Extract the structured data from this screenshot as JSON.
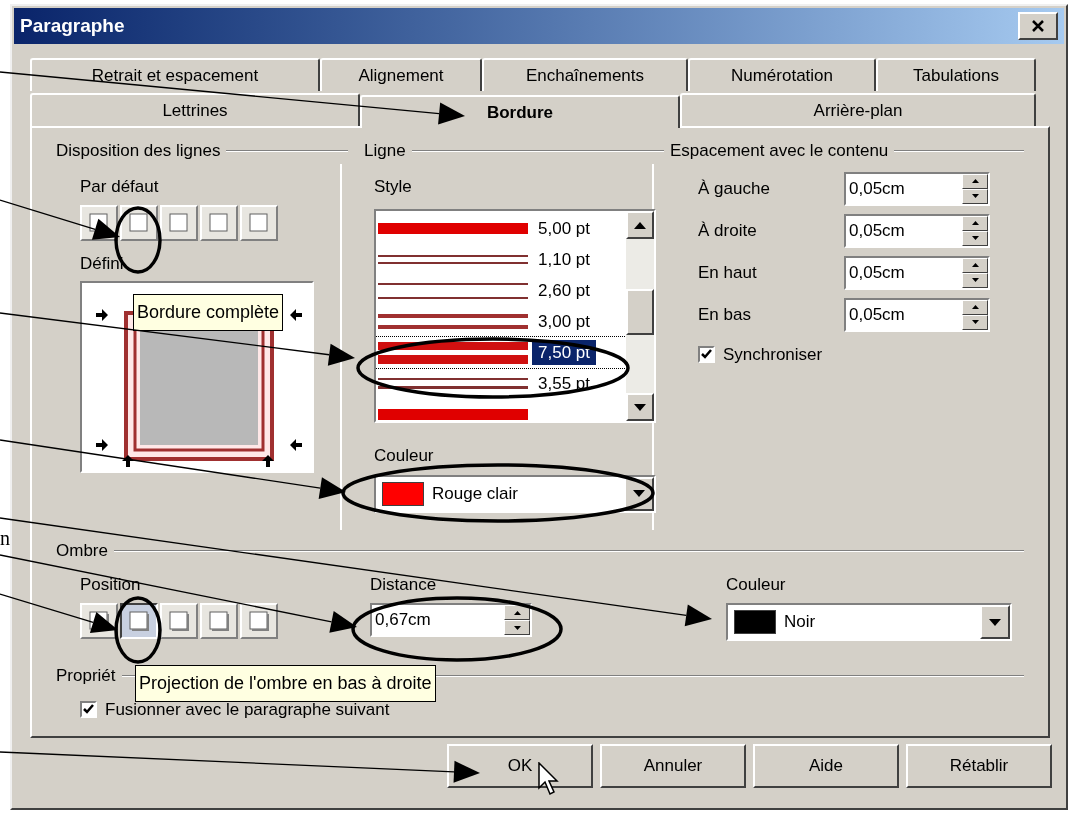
{
  "window": {
    "title": "Paragraphe"
  },
  "tabs_row_1": [
    {
      "label": "Retrait et espacement",
      "selected": false
    },
    {
      "label": "Alignement",
      "selected": false
    },
    {
      "label": "Enchaînements",
      "selected": false
    },
    {
      "label": "Numérotation",
      "selected": false
    },
    {
      "label": "Tabulations",
      "selected": false
    }
  ],
  "tabs_row_2": [
    {
      "label": "Lettrines",
      "selected": false
    },
    {
      "label": "Bordure",
      "selected": true
    },
    {
      "label": "Arrière-plan",
      "selected": false
    }
  ],
  "line_arrangement": {
    "title": "Disposition des lignes",
    "default_label": "Par défaut",
    "presets": [
      {
        "selected": false
      },
      {
        "selected": false
      },
      {
        "selected": false
      },
      {
        "selected": false
      },
      {
        "selected": false
      }
    ],
    "user_defined_label": "Défini"
  },
  "line": {
    "title": "Ligne",
    "style_label": "Style",
    "styles": [
      {
        "kind": "single_thick",
        "reading": "5,00 pt",
        "selected": false
      },
      {
        "kind": "double_thin",
        "reading": "1,10 pt",
        "selected": false
      },
      {
        "kind": "double_wide",
        "reading": "2,60 pt",
        "selected": false
      },
      {
        "kind": "double_medium",
        "reading": "3,00 pt",
        "selected": false
      },
      {
        "kind": "double_thick",
        "reading": "7,50 pt",
        "selected": true
      },
      {
        "kind": "double_thin_medium",
        "reading": "3,55 pt",
        "selected": false
      },
      {
        "kind": "single_thick",
        "selected": false
      }
    ],
    "color_label": "Couleur",
    "color": {
      "name": "Rouge clair",
      "color": "#ff0000"
    }
  },
  "spacing": {
    "title": "Espacement avec le contenu",
    "fields": [
      {
        "label": "À gauche",
        "value": "0,05cm"
      },
      {
        "label": "À droite",
        "value": "0,05cm"
      },
      {
        "label": "En haut",
        "value": "0,05cm"
      },
      {
        "label": "En bas",
        "value": "0,05cm"
      }
    ],
    "synchronize": {
      "label": "Synchroniser",
      "checked": true
    }
  },
  "shadow": {
    "title": "Ombre",
    "position_label": "Position",
    "positions": [
      {
        "selected": false
      },
      {
        "selected": true
      },
      {
        "selected": false
      },
      {
        "selected": false
      },
      {
        "selected": false
      }
    ],
    "distance_label": "Distance",
    "distance": "0,67cm",
    "color_label": "Couleur",
    "color": {
      "name": "Noir",
      "color": "#000000"
    }
  },
  "properties": {
    "title": "Propriét",
    "merge": {
      "label": "Fusionner avec le paragraphe suivant",
      "checked": true
    }
  },
  "buttons": [
    "OK",
    "Annuler",
    "Aide",
    "Rétablir"
  ],
  "tooltips": [
    "Bordure complète",
    "Projection de l'ombre en bas à droite"
  ],
  "annotation": {
    "fragment": "n"
  }
}
